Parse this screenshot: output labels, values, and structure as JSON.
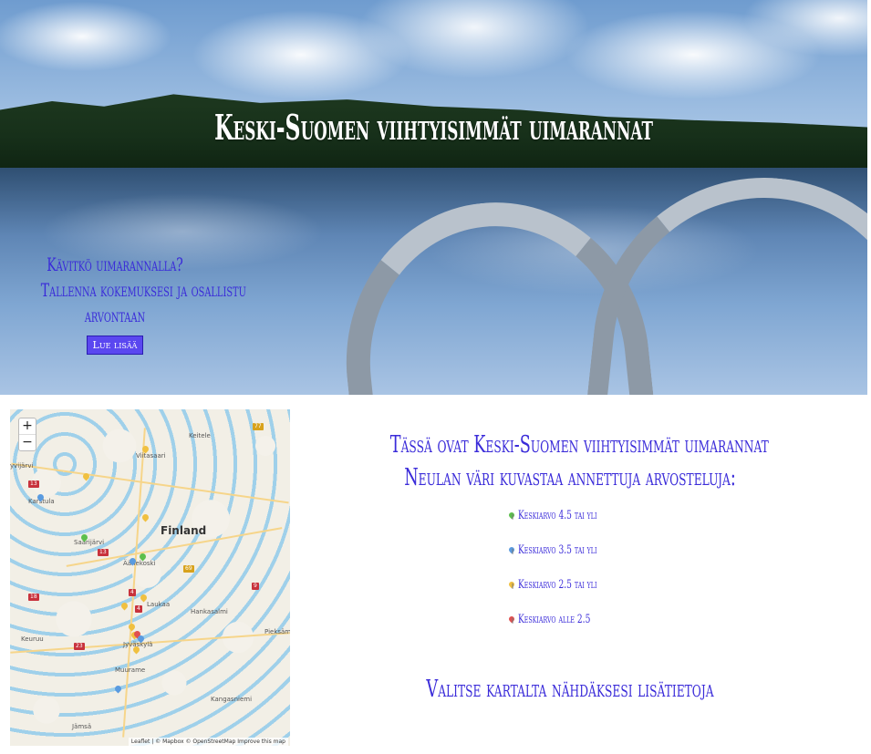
{
  "hero": {
    "title": "Keski-Suomen viihtyisimmät uimarannat",
    "promo_line1": "Kävitkö uimarannalla?",
    "promo_line2": "Tallenna kokemuksesi ja osallistu",
    "promo_line3": "arvontaan",
    "promo_button": "Lue lisää"
  },
  "map": {
    "zoom_in": "+",
    "zoom_out": "−",
    "country_label": "Finland",
    "places": [
      "Keitele",
      "Viitasaari",
      "Karstula",
      "Saarijärvi",
      "Äänekoski",
      "Laukaa",
      "Hankasalmi",
      "Pieksäm",
      "Keuruu",
      "Jyväskylä",
      "Muurame",
      "Kangasniemi",
      "Jämsä",
      "yvijärvi"
    ],
    "road_shields": [
      "77",
      "13",
      "13",
      "4",
      "9",
      "69",
      "23",
      "4",
      "18"
    ],
    "attribution": "Leaflet | © Mapbox © OpenStreetMap Improve this map",
    "pins": [
      {
        "color": "#f0c040"
      },
      {
        "color": "#f0c040"
      },
      {
        "color": "#f0c040"
      },
      {
        "color": "#5a9be0"
      },
      {
        "color": "#5cbf4c"
      },
      {
        "color": "#5a9be0"
      },
      {
        "color": "#5cbf4c"
      },
      {
        "color": "#f0c040"
      },
      {
        "color": "#f0c040"
      },
      {
        "color": "#f0c040"
      },
      {
        "color": "#f0c040"
      },
      {
        "color": "#e05050"
      },
      {
        "color": "#5a9be0"
      },
      {
        "color": "#f0c040"
      },
      {
        "color": "#5a9be0"
      }
    ]
  },
  "info": {
    "heading": "Tässä ovat Keski-Suomen viihtyisimmät uimarannat",
    "subheading": "Neulan väri kuvastaa annettuja arvosteluja:",
    "legend": [
      {
        "label": "Keskiarvo 4.5 tai yli",
        "color": "#5cbf4c"
      },
      {
        "label": "Keskiarvo 3.5 tai yli",
        "color": "#5a9be0"
      },
      {
        "label": "Keskiarvo 2.5 tai yli",
        "color": "#f0c040"
      },
      {
        "label": "Keskiarvo alle 2.5",
        "color": "#e05050"
      }
    ],
    "cta": "Valitse kartalta nähdäksesi lisätietoja"
  },
  "colors": {
    "accent": "#3a2bd9",
    "button": "#5a47f0"
  }
}
